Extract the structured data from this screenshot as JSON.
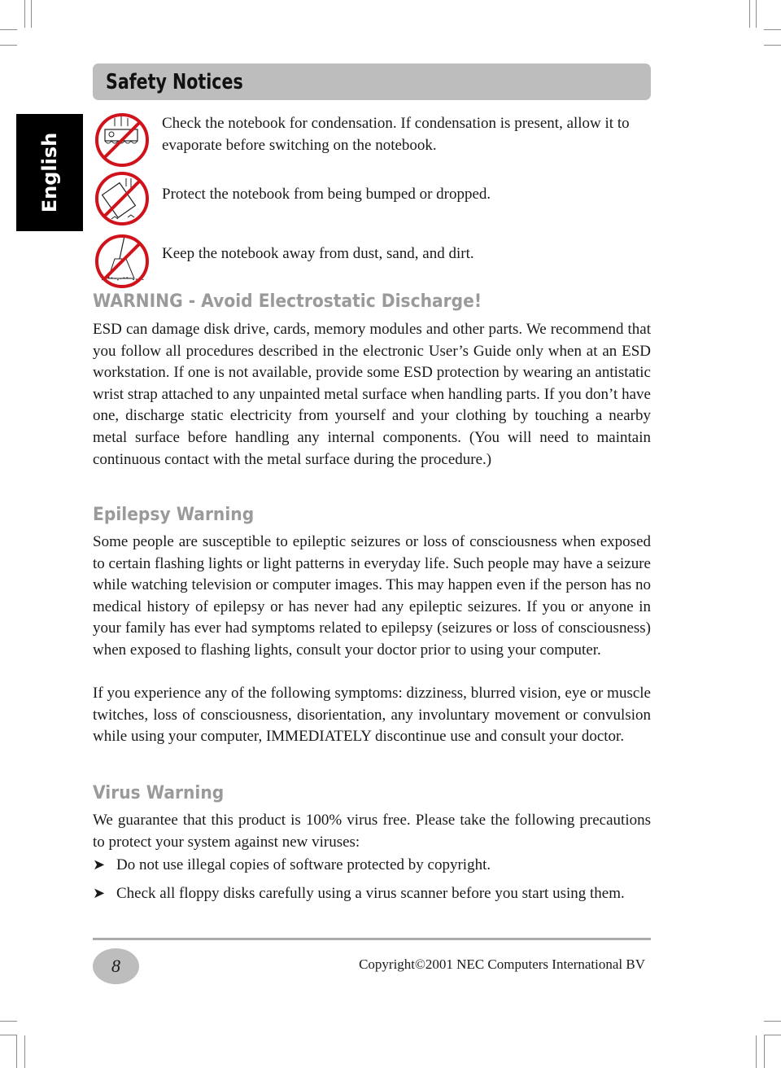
{
  "page": {
    "title": "Safety Notices",
    "language_tab": "English"
  },
  "notices": [
    {
      "icon": "no-condensation-icon",
      "text": "Check the notebook for condensation. If condensation is present, allow it to evaporate before switching on the notebook."
    },
    {
      "icon": "no-dropping-icon",
      "text": "Protect the notebook from being bumped or dropped."
    },
    {
      "icon": "no-dust-icon",
      "text": "Keep the notebook away from dust, sand, and dirt."
    }
  ],
  "esd": {
    "heading": "WARNING - Avoid Electrostatic Discharge!",
    "body": "ESD can damage disk drive, cards, memory modules and other parts. We recommend that you follow all procedures described in the electronic User’s Guide only when at an ESD workstation. If one is not available, provide some ESD protection by wearing an antistatic wrist strap attached to any unpainted metal surface when handling parts. If you don’t have one, discharge static electricity from yourself and your clothing by touching a nearby metal surface before handling any internal components. (You will need to maintain continuous contact with the metal surface during the procedure.)"
  },
  "epilepsy": {
    "heading": "Epilepsy Warning",
    "paragraph1": "Some people are susceptible to epileptic seizures or loss of consciousness when exposed to certain flashing lights or light patterns in everyday life. Such people may have a seizure while watching television or computer images. This may happen even if the person has no medical history of epilepsy or has never had any epileptic seizures. If you or anyone in your family has ever had symptoms related to epilepsy (seizures or loss of consciousness) when exposed to flashing lights, consult your doctor prior to using your computer.",
    "paragraph2": "If you experience any of the following symptoms: dizziness, blurred vision, eye or muscle twitches, loss of consciousness, disorientation, any involuntary movement or convulsion while using your computer, IMMEDIATELY discontinue use and consult your doctor."
  },
  "virus": {
    "heading": "Virus Warning",
    "intro": "We guarantee that this product is 100% virus free. Please take the following precautions to protect your system against new viruses:",
    "bullets": [
      "Do not use illegal copies of software protected by copyright.",
      "Check all floppy disks carefully using a virus scanner before you start using them."
    ],
    "bullet_glyph": "➤"
  },
  "footer": {
    "page_number": "8",
    "copyright": "Copyright©2001 NEC Computers International BV"
  },
  "colors": {
    "prohibition_red": "#d0121b",
    "heading_gray": "#9a9a9a",
    "title_bar_gray": "#bdbdbd"
  }
}
